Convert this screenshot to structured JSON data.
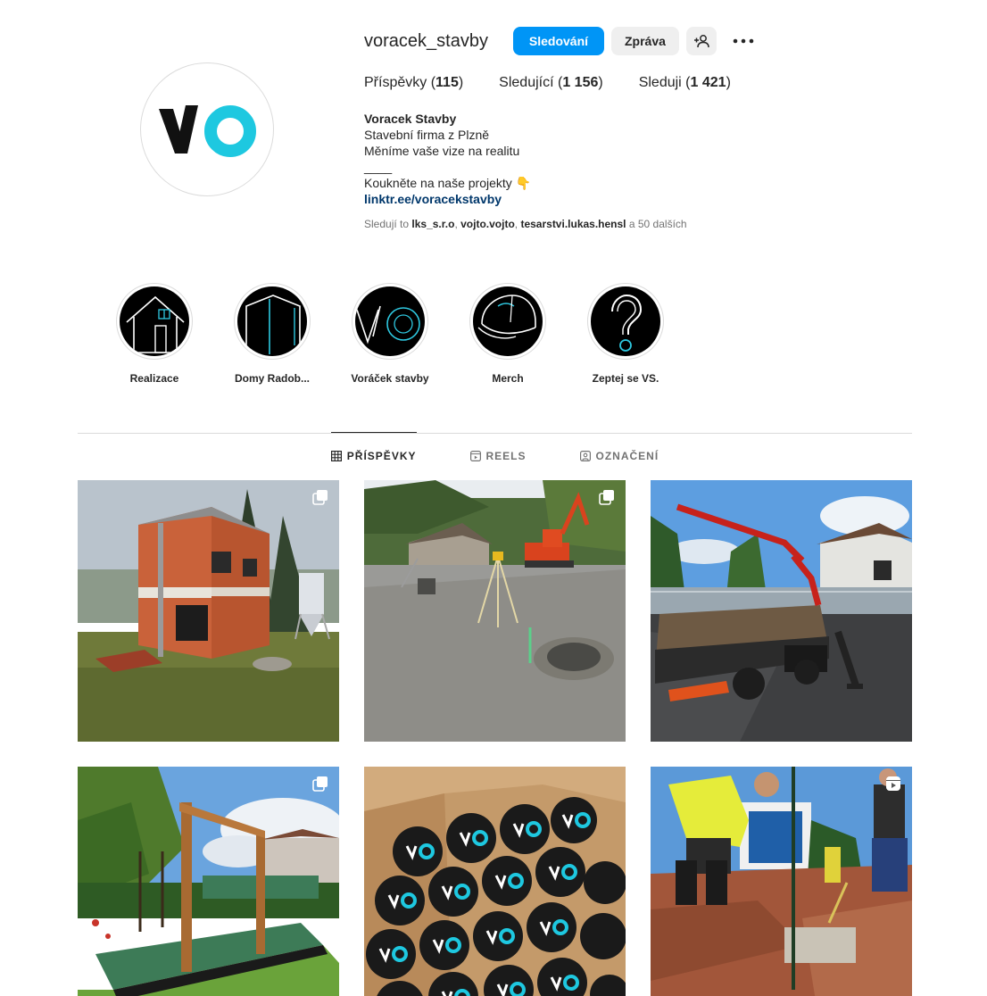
{
  "profile": {
    "username": "voracek_stavby",
    "follow_label": "Sledování",
    "message_label": "Zpráva",
    "avatar_text": "VO"
  },
  "stats": {
    "posts_label": "Příspěvky",
    "posts_count": "115",
    "followers_label": "Sledující",
    "followers_count": "1 156",
    "following_label": "Sleduji",
    "following_count": "1 421"
  },
  "bio": {
    "name": "Voracek Stavby",
    "line1": "Stavební firma z Plzně",
    "line2": "Měníme vaše vize na realitu",
    "line3": "____",
    "line4": "Koukněte na naše projekty 👇",
    "link": "linktr.ee/voracekstavby",
    "followed_prefix": "Sledují to",
    "followed_1": "lks_s.r.o",
    "followed_2": "vojto.vojto",
    "followed_3": "tesarstvi.lukas.hensl",
    "followed_suffix": "a 50 dalších"
  },
  "highlights": [
    {
      "label": "Realizace",
      "icon": "house-icon"
    },
    {
      "label": "Domy Radob...",
      "icon": "frame-house-icon"
    },
    {
      "label": "Voráček stavby",
      "icon": "logo-icon"
    },
    {
      "label": "Merch",
      "icon": "cap-icon"
    },
    {
      "label": "Zeptej se VS.",
      "icon": "question-icon"
    }
  ],
  "tabs": [
    {
      "label": "PŘÍSPĚVKY",
      "icon": "grid-icon",
      "active": true
    },
    {
      "label": "REELS",
      "icon": "reels-icon",
      "active": false
    },
    {
      "label": "OZNAČENÍ",
      "icon": "tagged-icon",
      "active": false
    }
  ],
  "posts": [
    {
      "subject": "brick-house",
      "badge": "carousel-icon"
    },
    {
      "subject": "excavator-site",
      "badge": "carousel-icon"
    },
    {
      "subject": "crane-truck",
      "badge": ""
    },
    {
      "subject": "wooden-pergola",
      "badge": "carousel-icon"
    },
    {
      "subject": "merch-box",
      "badge": ""
    },
    {
      "subject": "workers-trench",
      "badge": "reel-icon"
    }
  ],
  "colors": {
    "primary": "#0095f6",
    "logo_accent": "#1ec8e0",
    "link": "#00376b"
  }
}
